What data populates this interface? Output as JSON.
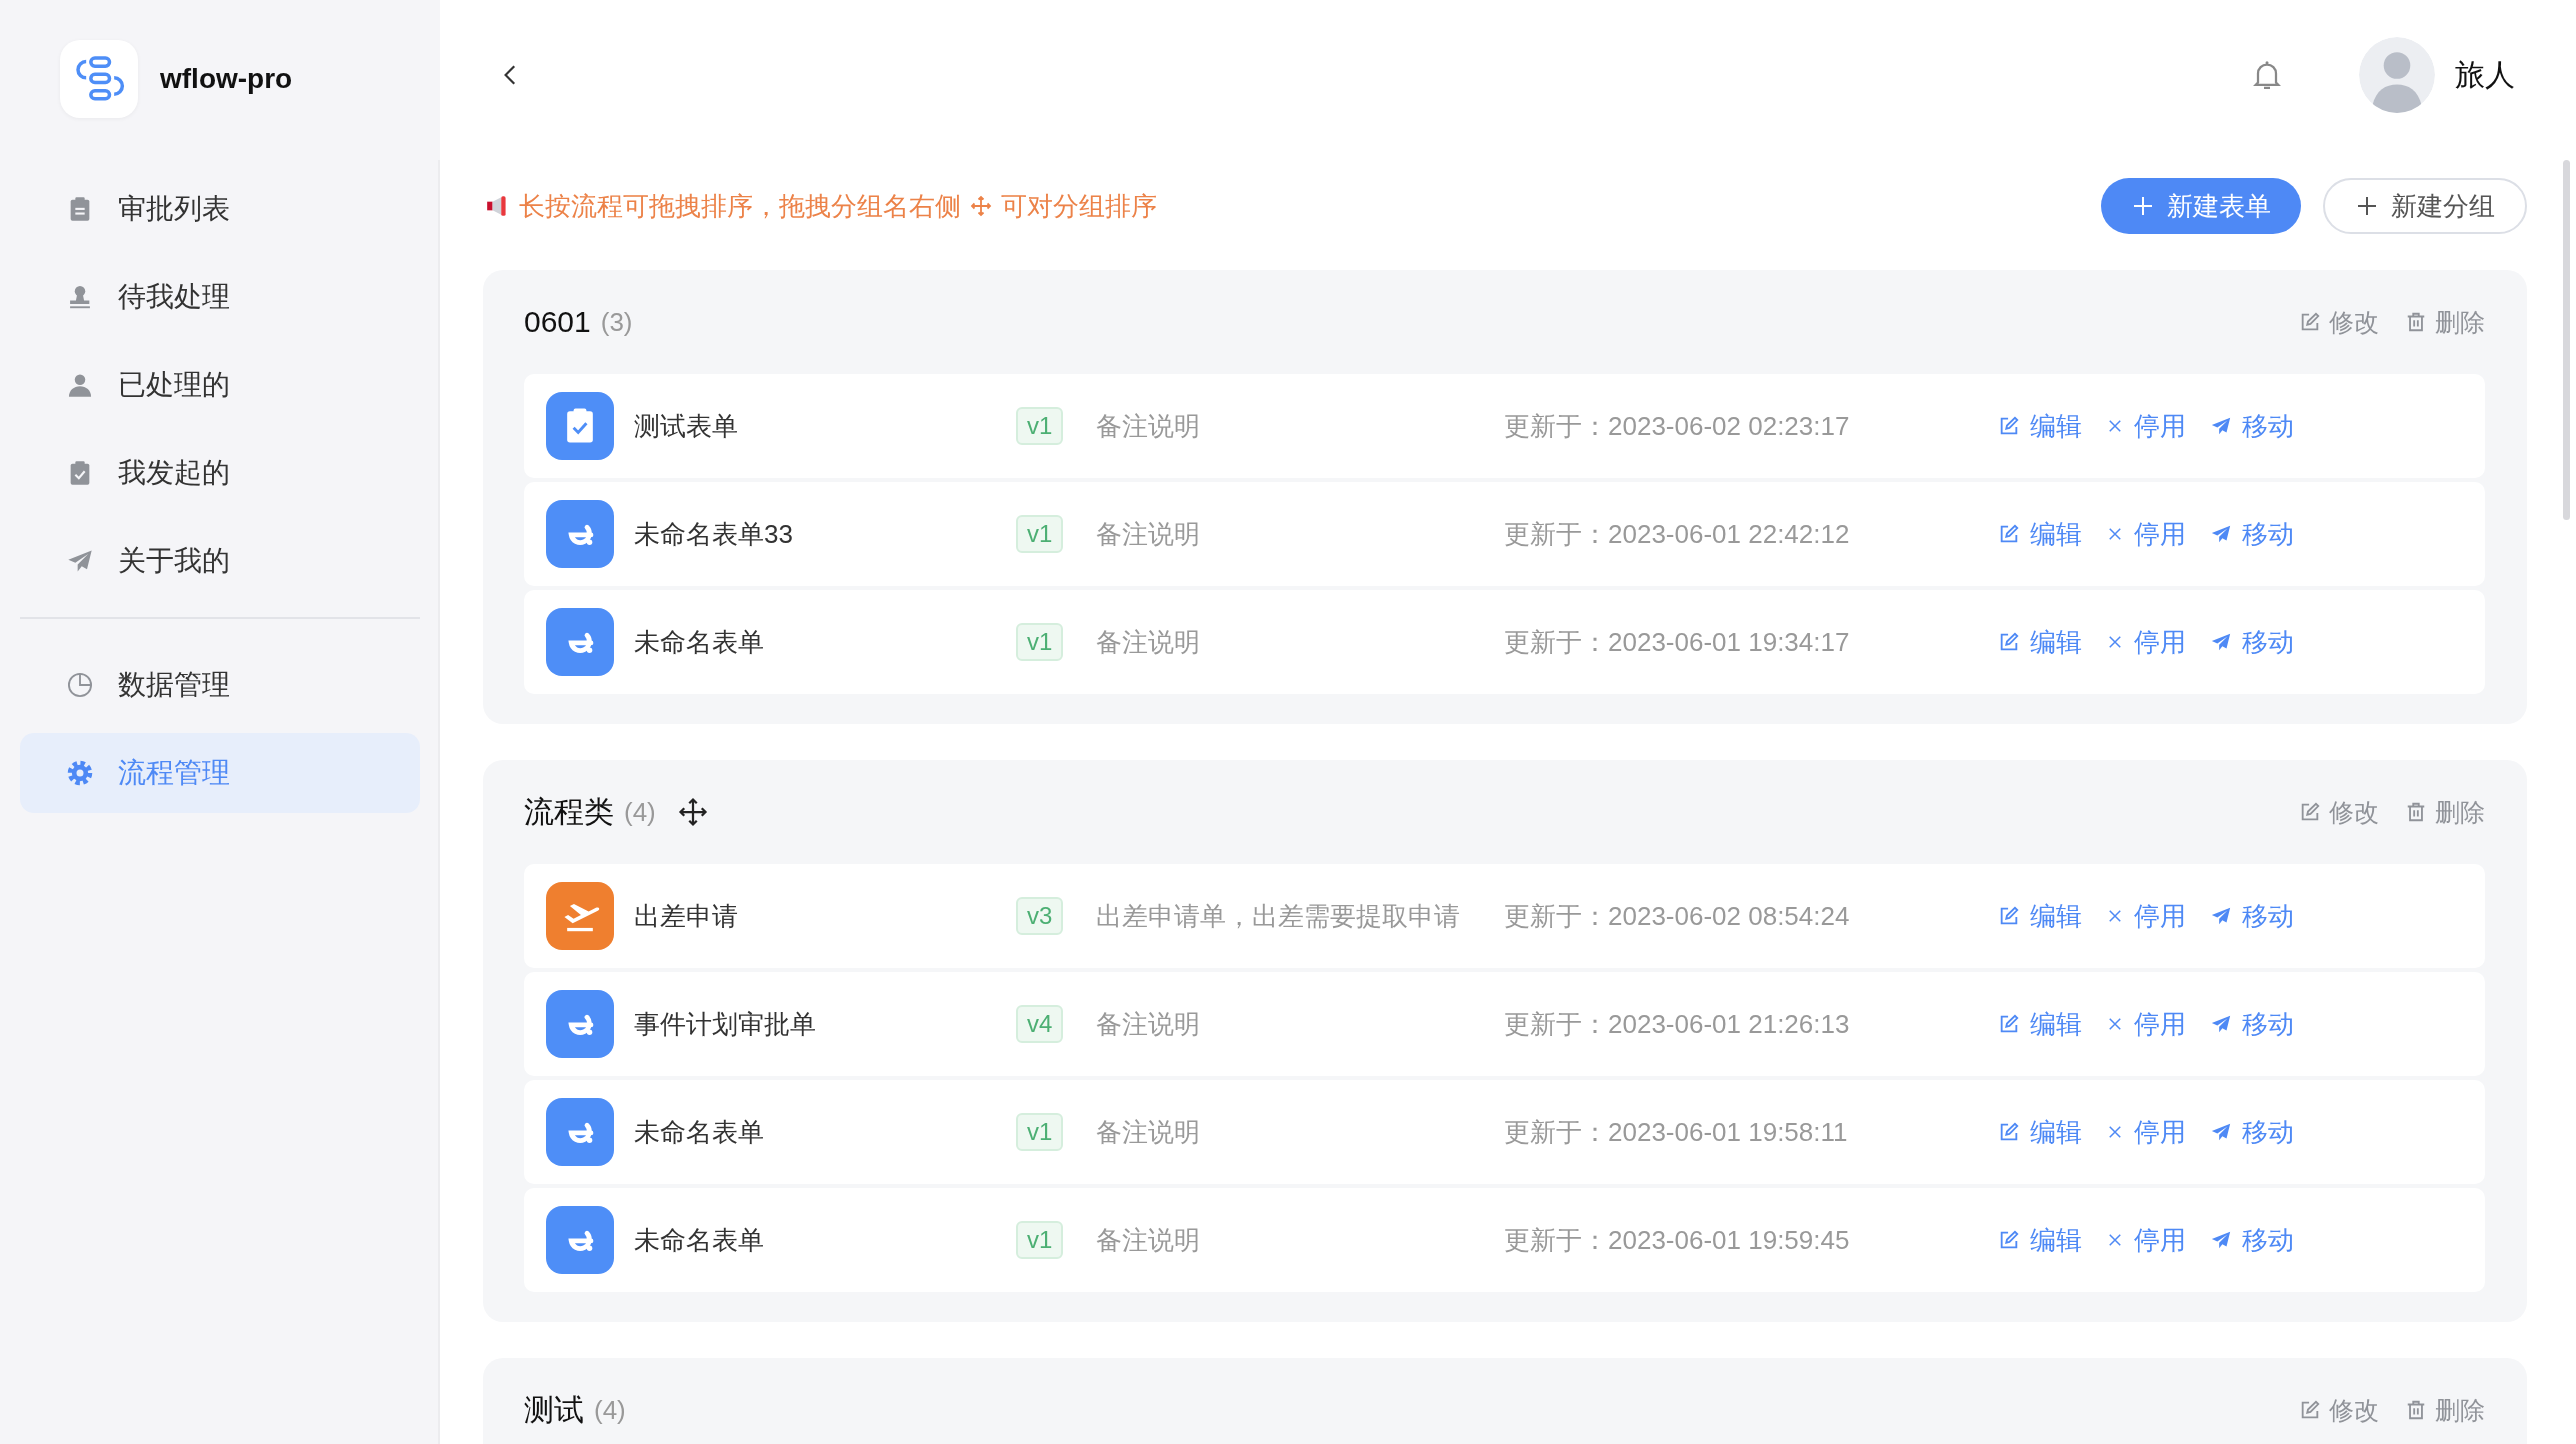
{
  "app": {
    "name": "wflow-pro"
  },
  "sidebar": {
    "sections": [
      {
        "items": [
          {
            "label": "审批列表",
            "kind": "clipboard",
            "selected": false
          },
          {
            "label": "待我处理",
            "kind": "stamp",
            "selected": false
          },
          {
            "label": "已处理的",
            "kind": "person",
            "selected": false
          },
          {
            "label": "我发起的",
            "kind": "check",
            "selected": false
          },
          {
            "label": "关于我的",
            "kind": "send",
            "selected": false
          }
        ]
      },
      {
        "items": [
          {
            "label": "数据管理",
            "kind": "pie",
            "selected": false
          },
          {
            "label": "流程管理",
            "kind": "gear",
            "selected": true
          }
        ]
      }
    ]
  },
  "header": {
    "user_name": "旅人"
  },
  "notice": {
    "parts": [
      "长按流程可拖拽排序，拖拽分组名右侧",
      "可对分组排序"
    ]
  },
  "toolbar": {
    "buttons": [
      {
        "label": "新建表单",
        "kind": "primary"
      },
      {
        "label": "新建分组",
        "kind": "default"
      }
    ]
  },
  "groups": [
    {
      "name": "0601",
      "count": "(3)",
      "drag_handle": false,
      "actions": [
        {
          "label": "修改",
          "kind": "edit"
        },
        {
          "label": "删除",
          "kind": "delete"
        }
      ],
      "forms": [
        {
          "name": "测试表单",
          "kind": "clipboard",
          "color": "#4e8ef7",
          "version": "v1",
          "note": "备注说明",
          "updated": "更新于：2023-06-02 02:23:17",
          "actions": [
            {
              "label": "编辑",
              "kind": "edit"
            },
            {
              "label": "停用",
              "kind": "disable"
            },
            {
              "label": "移动",
              "kind": "move"
            }
          ]
        },
        {
          "name": "未命名表单33",
          "kind": "flow",
          "color": "#4e8ef7",
          "version": "v1",
          "note": "备注说明",
          "updated": "更新于：2023-06-01 22:42:12",
          "actions": [
            {
              "label": "编辑",
              "kind": "edit"
            },
            {
              "label": "停用",
              "kind": "disable"
            },
            {
              "label": "移动",
              "kind": "move"
            }
          ]
        },
        {
          "name": "未命名表单",
          "kind": "flow",
          "color": "#4e8ef7",
          "version": "v1",
          "note": "备注说明",
          "updated": "更新于：2023-06-01 19:34:17",
          "actions": [
            {
              "label": "编辑",
              "kind": "edit"
            },
            {
              "label": "停用",
              "kind": "disable"
            },
            {
              "label": "移动",
              "kind": "move"
            }
          ]
        }
      ]
    },
    {
      "name": "流程类",
      "count": "(4)",
      "drag_handle": true,
      "actions": [
        {
          "label": "修改",
          "kind": "edit"
        },
        {
          "label": "删除",
          "kind": "delete"
        }
      ],
      "forms": [
        {
          "name": "出差申请",
          "kind": "plane",
          "color": "#ef7f2f",
          "version": "v3",
          "note": "出差申请单，出差需要提取申请",
          "updated": "更新于：2023-06-02 08:54:24",
          "actions": [
            {
              "label": "编辑",
              "kind": "edit"
            },
            {
              "label": "停用",
              "kind": "disable"
            },
            {
              "label": "移动",
              "kind": "move"
            }
          ]
        },
        {
          "name": "事件计划审批单",
          "kind": "flow",
          "color": "#4e8ef7",
          "version": "v4",
          "note": "备注说明",
          "updated": "更新于：2023-06-01 21:26:13",
          "actions": [
            {
              "label": "编辑",
              "kind": "edit"
            },
            {
              "label": "停用",
              "kind": "disable"
            },
            {
              "label": "移动",
              "kind": "move"
            }
          ]
        },
        {
          "name": "未命名表单",
          "kind": "flow",
          "color": "#4e8ef7",
          "version": "v1",
          "note": "备注说明",
          "updated": "更新于：2023-06-01 19:58:11",
          "actions": [
            {
              "label": "编辑",
              "kind": "edit"
            },
            {
              "label": "停用",
              "kind": "disable"
            },
            {
              "label": "移动",
              "kind": "move"
            }
          ]
        },
        {
          "name": "未命名表单",
          "kind": "flow",
          "color": "#4e8ef7",
          "version": "v1",
          "note": "备注说明",
          "updated": "更新于：2023-06-01 19:59:45",
          "actions": [
            {
              "label": "编辑",
              "kind": "edit"
            },
            {
              "label": "停用",
              "kind": "disable"
            },
            {
              "label": "移动",
              "kind": "move"
            }
          ]
        }
      ]
    },
    {
      "name": "测试",
      "count": "(4)",
      "drag_handle": false,
      "actions": [
        {
          "label": "修改",
          "kind": "edit"
        },
        {
          "label": "删除",
          "kind": "delete"
        }
      ]
    }
  ]
}
